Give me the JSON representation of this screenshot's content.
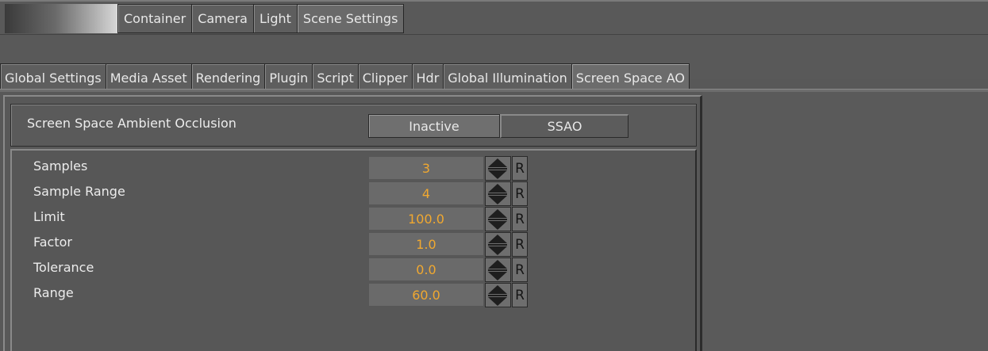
{
  "top_tabs": [
    {
      "label": "Container",
      "active": false
    },
    {
      "label": "Camera",
      "active": false
    },
    {
      "label": "Light",
      "active": false
    },
    {
      "label": "Scene Settings",
      "active": true
    }
  ],
  "sub_tabs": [
    {
      "label": "Global Settings",
      "active": false
    },
    {
      "label": "Media Asset",
      "active": false
    },
    {
      "label": "Rendering",
      "active": false
    },
    {
      "label": "Plugin",
      "active": false
    },
    {
      "label": "Script",
      "active": false
    },
    {
      "label": "Clipper",
      "active": false
    },
    {
      "label": "Hdr",
      "active": false
    },
    {
      "label": "Global Illumination",
      "active": false
    },
    {
      "label": "Screen Space AO",
      "active": true
    }
  ],
  "ssao": {
    "label": "Screen Space Ambient Occlusion",
    "inactive_label": "Inactive",
    "active_label": "SSAO",
    "selected": "SSAO"
  },
  "params": [
    {
      "label": "Samples",
      "value": "3"
    },
    {
      "label": "Sample Range",
      "value": "4"
    },
    {
      "label": "Limit",
      "value": "100.0"
    },
    {
      "label": "Factor",
      "value": "1.0"
    },
    {
      "label": "Tolerance",
      "value": "0.0"
    },
    {
      "label": "Range",
      "value": "60.0"
    }
  ],
  "reset_label": "R",
  "colors": {
    "background": "#585858",
    "value_text": "#f0a830",
    "label_text": "#ececec"
  }
}
